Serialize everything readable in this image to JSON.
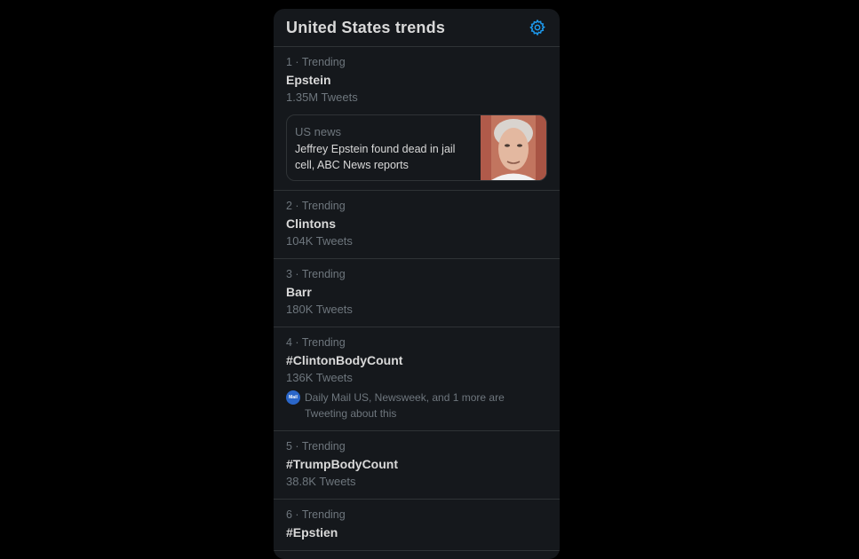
{
  "header": {
    "title": "United States trends",
    "settings_icon": "gear-icon",
    "accent": "#1d9bf0"
  },
  "trends": [
    {
      "meta": "1 · Trending",
      "name": "Epstein",
      "count": "1.35M Tweets",
      "news": {
        "category": "US news",
        "headline": "Jeffrey Epstein found dead in jail cell, ABC News reports"
      }
    },
    {
      "meta": "2 · Trending",
      "name": "Clintons",
      "count": "104K Tweets"
    },
    {
      "meta": "3 · Trending",
      "name": "Barr",
      "count": "180K Tweets"
    },
    {
      "meta": "4 · Trending",
      "name": "#ClintonBodyCount",
      "count": "136K Tweets",
      "context": {
        "avatar_label": "Mail",
        "text": "Daily Mail US, Newsweek, and 1 more are Tweeting about this"
      }
    },
    {
      "meta": "5 · Trending",
      "name": "#TrumpBodyCount",
      "count": "38.8K Tweets"
    },
    {
      "meta": "6 · Trending",
      "name": "#Epstien",
      "count": ""
    }
  ]
}
